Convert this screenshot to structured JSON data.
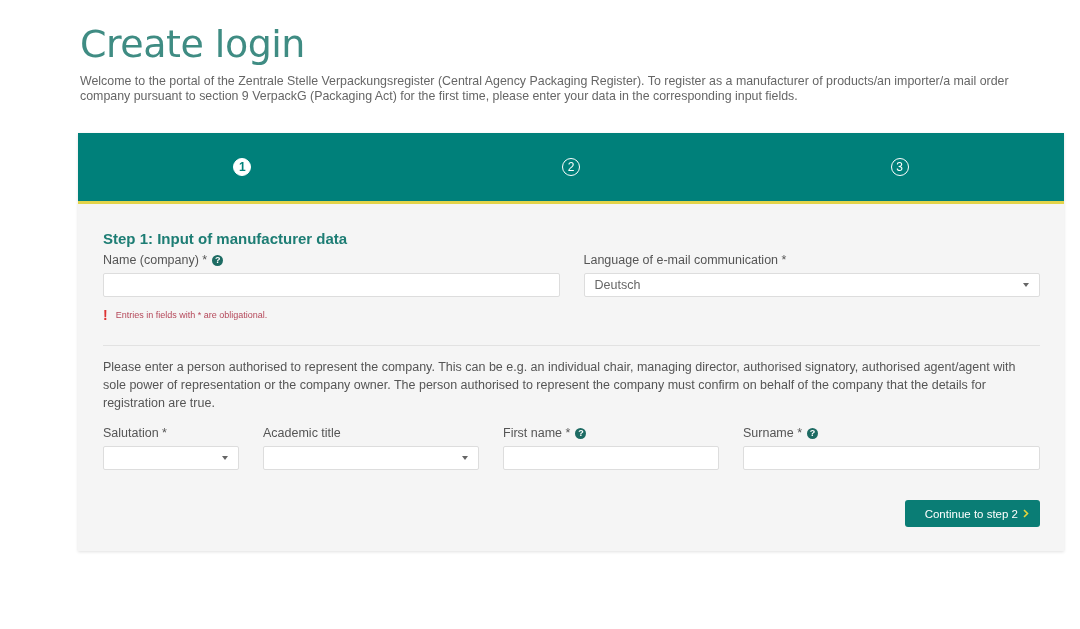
{
  "title": "Create login",
  "intro": "Welcome to the portal of the Zentrale Stelle Verpackungsregister (Central Agency Packaging Register). To register as a manufacturer of products/an importer/a mail order company pursuant to section 9 VerpackG (Packaging Act) for the first time, please enter your data in the corresponding input fields.",
  "steps": [
    {
      "number": "1",
      "selected": true
    },
    {
      "number": "2",
      "selected": false
    },
    {
      "number": "3",
      "selected": false
    }
  ],
  "section_title": "Step 1: Input of manufacturer data",
  "company_fields": [
    {
      "kind": "text",
      "label": "Name (company) *",
      "help": "?"
    },
    {
      "kind": "select",
      "label": "Language of e-mail communication *",
      "value": "Deutsch"
    }
  ],
  "error": {
    "mark": "!",
    "text": "Entries in fields with * are obligational."
  },
  "person_note": "Please enter a person authorised to represent the company. This can be e.g. an individual chair, managing director, authorised signatory, authorised agent/agent with sole power of representation or the company owner. The person authorised to represent the company must confirm on behalf of the company that the details for registration are true.",
  "person_fields": [
    {
      "kind": "select",
      "label": "Salutation *"
    },
    {
      "kind": "select",
      "label": "Academic title"
    },
    {
      "kind": "text",
      "label": "First name *",
      "help": "?"
    },
    {
      "kind": "text",
      "label": "Surname *",
      "help": "?"
    }
  ],
  "continue_button": "Continue to step 2"
}
